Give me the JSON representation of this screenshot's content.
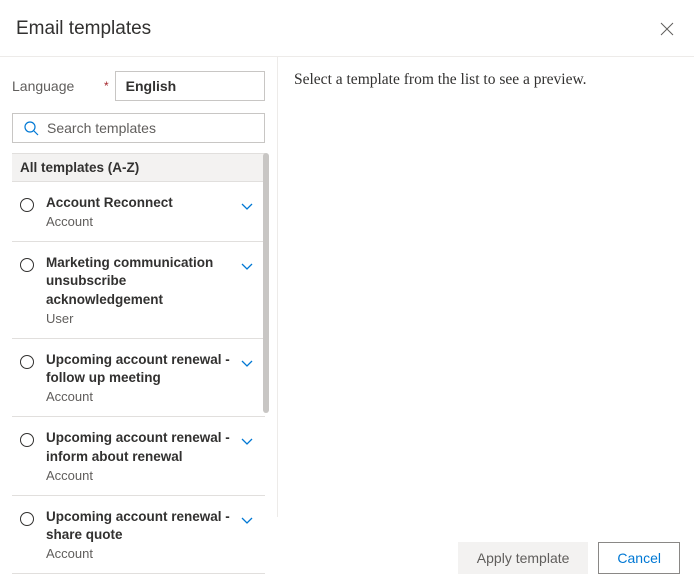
{
  "header": {
    "title": "Email templates"
  },
  "language": {
    "label": "Language",
    "value": "English"
  },
  "search": {
    "placeholder": "Search templates"
  },
  "list": {
    "section_header": "All templates (A-Z)",
    "items": [
      {
        "title": "Account Reconnect",
        "subtitle": "Account"
      },
      {
        "title": "Marketing communication unsubscribe acknowledgement",
        "subtitle": "User"
      },
      {
        "title": "Upcoming account renewal - follow up meeting",
        "subtitle": "Account"
      },
      {
        "title": "Upcoming account renewal - inform about renewal",
        "subtitle": "Account"
      },
      {
        "title": "Upcoming account renewal - share quote",
        "subtitle": "Account"
      }
    ]
  },
  "preview": {
    "placeholder": "Select a template from the list to see a preview."
  },
  "footer": {
    "apply_label": "Apply template",
    "cancel_label": "Cancel"
  }
}
